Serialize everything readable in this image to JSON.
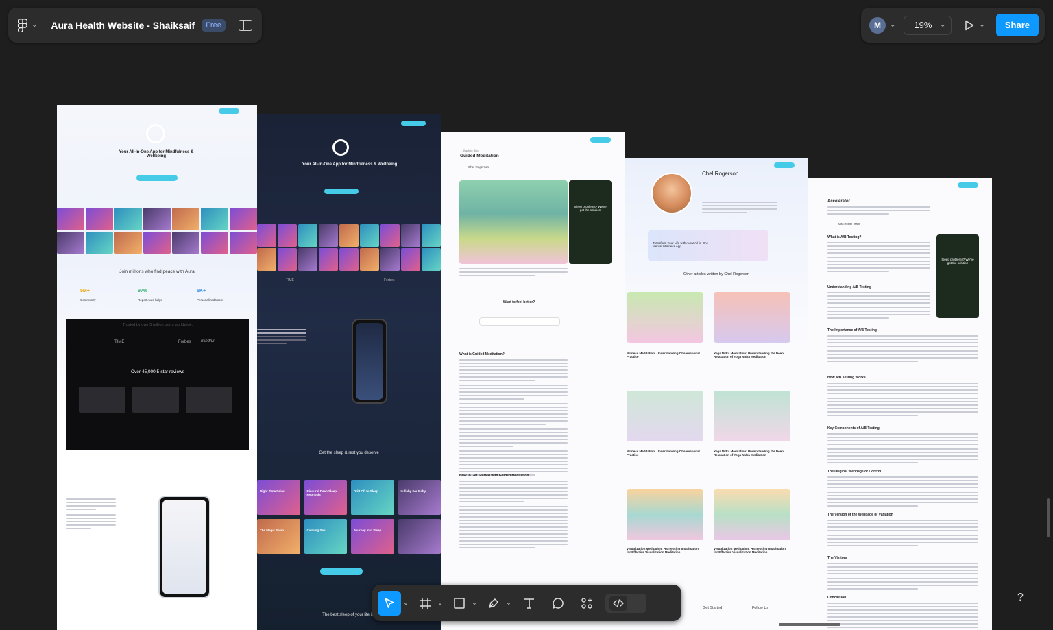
{
  "file": {
    "title": "Aura Health Website - Shaiksaif",
    "plan": "Free"
  },
  "header": {
    "avatar_initial": "M",
    "zoom": "19%",
    "share_label": "Share"
  },
  "frames": {
    "home_light": {
      "hero": "Your All-In-One App for Mindfulness & Wellbeing",
      "join": "Join millions who find peace with Aura",
      "stats": [
        {
          "value": "5M+",
          "label": "Community"
        },
        {
          "value": "97%",
          "label": "Report Aura helps"
        },
        {
          "value": "5K+",
          "label": "Personalized tracks"
        }
      ],
      "trusted": "Trusted by over 5 million users worldwide.",
      "press": [
        "TIME",
        "Forbes",
        "mindful"
      ],
      "reviews_title": "Over 45,000 5-star reviews"
    },
    "home_dark": {
      "hero": "Your All-In-One App for Mindfulness & Wellbeing",
      "sleep": "Get the sleep & rest you deserve",
      "press": [
        "TIME",
        "Forbes"
      ],
      "tracks": [
        "Night Time Drive",
        "Binaural Deep Sleep Hypnosis",
        "Drift Off to Sleep",
        "The Magic Swan",
        "Calming Sea",
        "Journey Into Sleep",
        "Lullaby For Baby"
      ],
      "best_sleep": "The best sleep of your life is ju... the start"
    },
    "article": {
      "breadcrumb": "← Back to Blog",
      "title": "Guided Meditation",
      "author": "Chel Rogerson",
      "ad_title": "Sleep problems? We've got the solution",
      "feel_better": "Want to feel better?",
      "section1": "What is Guided Meditation?",
      "section2": "How to Get Started with Guided Meditation"
    },
    "author_page": {
      "name": "Chel Rogerson",
      "banner": "Transform Your Life with Aura! All-in-One Mental Wellness App",
      "other": "Other articles written by Chel Rogerson",
      "articles": [
        "Witness Meditation: Understanding Observational Practice",
        "Yoga Nidra Meditation: Understanding the Deep Relaxation of Yoga Nidra Meditation",
        "Witness Meditation: Understanding Observational Practice",
        "Yoga Nidra Meditation: Understanding the Deep Relaxation of Yoga Nidra Meditation",
        "Visualization Meditation: Harnessing Imagination for Effective Visualization Meditation",
        "Visualization Meditation: Harnessing Imagination for Effective Visualization Meditation"
      ],
      "footer": [
        "Get Started",
        "Follow Us"
      ]
    },
    "accelerator": {
      "title": "Accelerator",
      "author": "Aura Health Team",
      "ad_title": "Sleep problems? We've got the solution",
      "sections": [
        "What is A/B Testing?",
        "Understanding A/B Testing",
        "The Importance of A/B Testing",
        "How A/B Testing Works",
        "Key Components of A/B Testing",
        "The Original Webpage or Control",
        "The Version of the Webpage or Variation",
        "The Visitors",
        "Conclusion"
      ]
    }
  },
  "toolbar": {
    "tools": [
      "move-tool",
      "frame-tool",
      "shape-tool",
      "pen-tool",
      "text-tool",
      "comment-tool",
      "actions-tool",
      "dev-mode-toggle"
    ]
  },
  "help": "?"
}
